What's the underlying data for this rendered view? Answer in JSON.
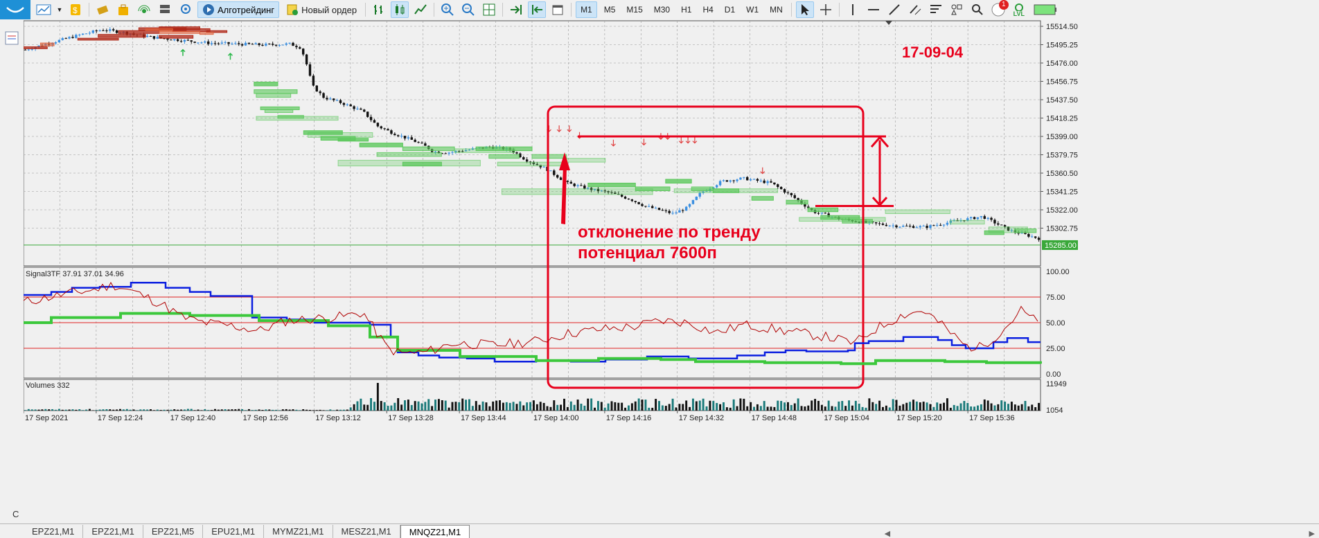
{
  "toolbar": {
    "algo_label": "Алготрейдинг",
    "new_order_label": "Новый ордер",
    "timeframes": [
      "M1",
      "M5",
      "M15",
      "M30",
      "H1",
      "H4",
      "D1",
      "W1",
      "MN"
    ],
    "active_timeframe": "M1",
    "notification_count": "1",
    "lvl_label": "LVL"
  },
  "price_scale": {
    "labels": [
      "15514.50",
      "15495.25",
      "15476.00",
      "15456.75",
      "15437.50",
      "15418.25",
      "15399.00",
      "15379.75",
      "15360.50",
      "15341.25",
      "15322.00",
      "15302.75"
    ],
    "current_price": "15285.00"
  },
  "indicator": {
    "header": "Signal3TF 37.91 37.01 34.96",
    "levels": [
      "100.00",
      "75.00",
      "50.00",
      "25.00",
      "0.00"
    ]
  },
  "volumes": {
    "header": "Volumes 332",
    "top_label": "11949",
    "bottom_label": "1054"
  },
  "time_axis": [
    "17 Sep 2021",
    "17 Sep 12:24",
    "17 Sep 12:40",
    "17 Sep 12:56",
    "17 Sep 13:12",
    "17 Sep 13:28",
    "17 Sep 13:44",
    "17 Sep 14:00",
    "17 Sep 14:16",
    "17 Sep 14:32",
    "17 Sep 14:48",
    "17 Sep 15:04",
    "17 Sep 15:20",
    "17 Sep 15:36"
  ],
  "annotations": {
    "date_stamp": "17-09-04",
    "line1": "отклонение по тренду",
    "line2": "потенциал 7600п"
  },
  "tabs": [
    "EPZ21,M1",
    "EPZ21,M1",
    "EPZ21,M5",
    "EPU21,M1",
    "MYMZ21,M1",
    "MESZ21,M1",
    "MNQZ21,M1"
  ],
  "active_tab": "MNQZ21,M1",
  "bottom_left_label": "C",
  "colors": {
    "bull": "#3b8fe0",
    "bear": "#111111",
    "zone_green": "#5cc85c",
    "zone_red": "#e0603a",
    "annotation_red": "#e8001c",
    "signal_blue": "#0a1ee0",
    "signal_green": "#3cc83c",
    "signal_red": "#b00000"
  }
}
